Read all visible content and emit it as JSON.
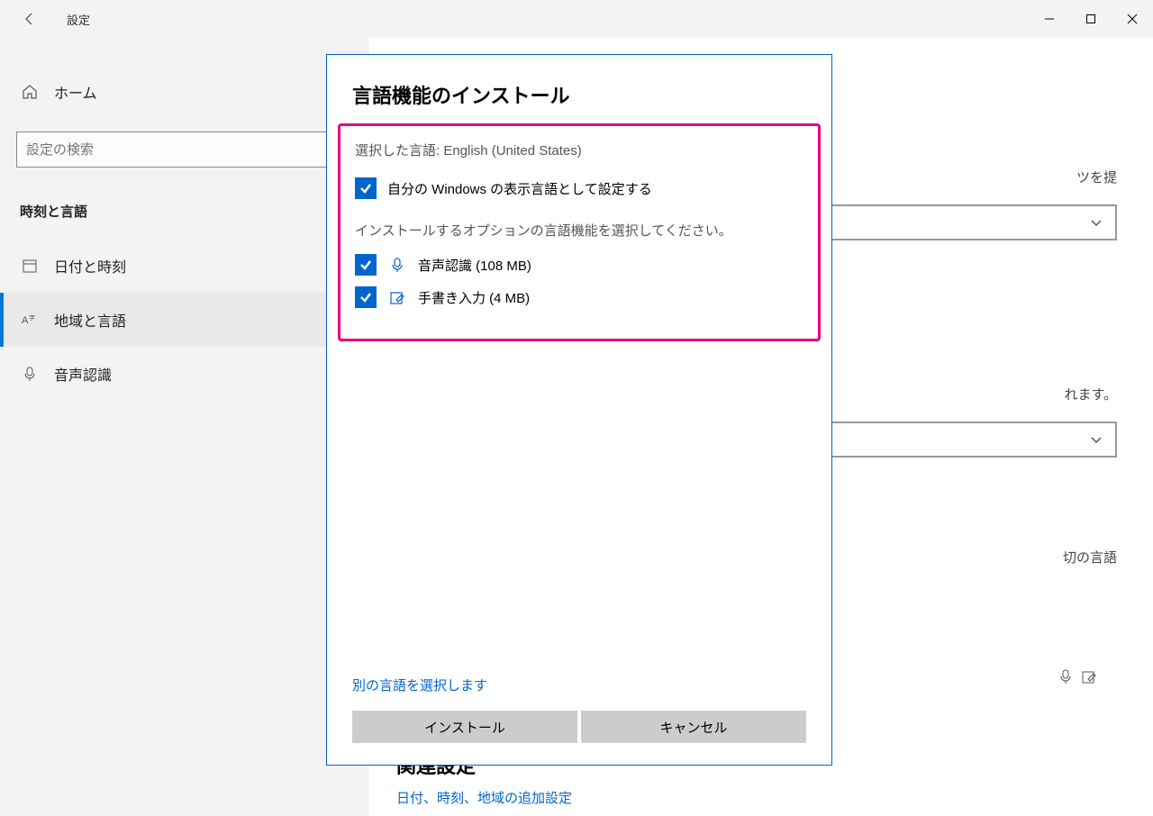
{
  "titlebar": {
    "title": "設定"
  },
  "sidebar": {
    "home": "ホーム",
    "search_placeholder": "設定の検索",
    "section": "時刻と言語",
    "items": [
      {
        "label": "日付と時刻"
      },
      {
        "label": "地域と言語"
      },
      {
        "label": "音声認識"
      }
    ]
  },
  "content": {
    "bg_text1": "ツを提",
    "bg_text2": "れます。",
    "bg_text3": "切の言語",
    "related_heading": "関連設定",
    "related_link": "日付、時刻、地域の追加設定"
  },
  "modal": {
    "title": "言語機能のインストール",
    "selected_language": "選択した言語: English (United States)",
    "set_display": "自分の Windows の表示言語として設定する",
    "instructions": "インストールするオプションの言語機能を選択してください。",
    "opt_speech": "音声認識 (108 MB)",
    "opt_handwriting": "手書き入力 (4 MB)",
    "choose_other": "別の言語を選択します",
    "btn_install": "インストール",
    "btn_cancel": "キャンセル"
  }
}
